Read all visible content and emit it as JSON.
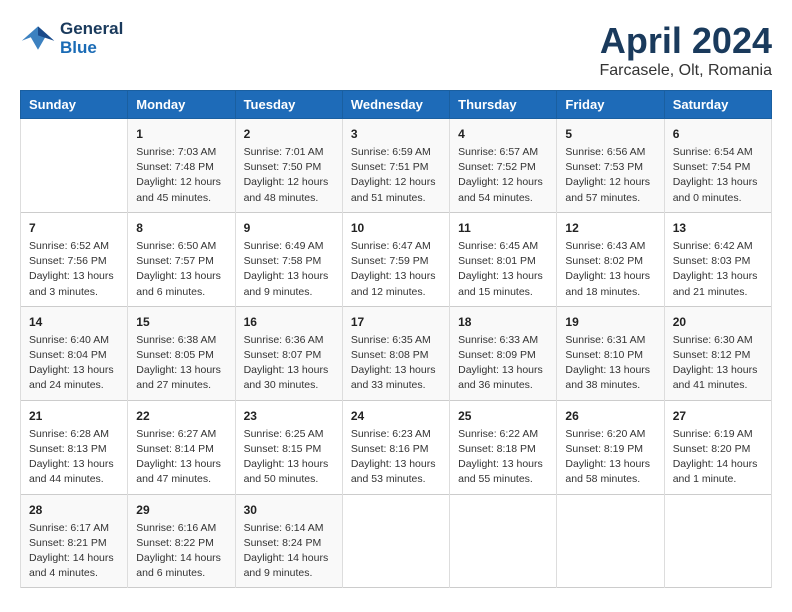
{
  "header": {
    "logo_line1": "General",
    "logo_line2": "Blue",
    "month": "April 2024",
    "location": "Farcasele, Olt, Romania"
  },
  "days_of_week": [
    "Sunday",
    "Monday",
    "Tuesday",
    "Wednesday",
    "Thursday",
    "Friday",
    "Saturday"
  ],
  "weeks": [
    [
      {
        "day": "",
        "info": ""
      },
      {
        "day": "1",
        "info": "Sunrise: 7:03 AM\nSunset: 7:48 PM\nDaylight: 12 hours\nand 45 minutes."
      },
      {
        "day": "2",
        "info": "Sunrise: 7:01 AM\nSunset: 7:50 PM\nDaylight: 12 hours\nand 48 minutes."
      },
      {
        "day": "3",
        "info": "Sunrise: 6:59 AM\nSunset: 7:51 PM\nDaylight: 12 hours\nand 51 minutes."
      },
      {
        "day": "4",
        "info": "Sunrise: 6:57 AM\nSunset: 7:52 PM\nDaylight: 12 hours\nand 54 minutes."
      },
      {
        "day": "5",
        "info": "Sunrise: 6:56 AM\nSunset: 7:53 PM\nDaylight: 12 hours\nand 57 minutes."
      },
      {
        "day": "6",
        "info": "Sunrise: 6:54 AM\nSunset: 7:54 PM\nDaylight: 13 hours\nand 0 minutes."
      }
    ],
    [
      {
        "day": "7",
        "info": "Sunrise: 6:52 AM\nSunset: 7:56 PM\nDaylight: 13 hours\nand 3 minutes."
      },
      {
        "day": "8",
        "info": "Sunrise: 6:50 AM\nSunset: 7:57 PM\nDaylight: 13 hours\nand 6 minutes."
      },
      {
        "day": "9",
        "info": "Sunrise: 6:49 AM\nSunset: 7:58 PM\nDaylight: 13 hours\nand 9 minutes."
      },
      {
        "day": "10",
        "info": "Sunrise: 6:47 AM\nSunset: 7:59 PM\nDaylight: 13 hours\nand 12 minutes."
      },
      {
        "day": "11",
        "info": "Sunrise: 6:45 AM\nSunset: 8:01 PM\nDaylight: 13 hours\nand 15 minutes."
      },
      {
        "day": "12",
        "info": "Sunrise: 6:43 AM\nSunset: 8:02 PM\nDaylight: 13 hours\nand 18 minutes."
      },
      {
        "day": "13",
        "info": "Sunrise: 6:42 AM\nSunset: 8:03 PM\nDaylight: 13 hours\nand 21 minutes."
      }
    ],
    [
      {
        "day": "14",
        "info": "Sunrise: 6:40 AM\nSunset: 8:04 PM\nDaylight: 13 hours\nand 24 minutes."
      },
      {
        "day": "15",
        "info": "Sunrise: 6:38 AM\nSunset: 8:05 PM\nDaylight: 13 hours\nand 27 minutes."
      },
      {
        "day": "16",
        "info": "Sunrise: 6:36 AM\nSunset: 8:07 PM\nDaylight: 13 hours\nand 30 minutes."
      },
      {
        "day": "17",
        "info": "Sunrise: 6:35 AM\nSunset: 8:08 PM\nDaylight: 13 hours\nand 33 minutes."
      },
      {
        "day": "18",
        "info": "Sunrise: 6:33 AM\nSunset: 8:09 PM\nDaylight: 13 hours\nand 36 minutes."
      },
      {
        "day": "19",
        "info": "Sunrise: 6:31 AM\nSunset: 8:10 PM\nDaylight: 13 hours\nand 38 minutes."
      },
      {
        "day": "20",
        "info": "Sunrise: 6:30 AM\nSunset: 8:12 PM\nDaylight: 13 hours\nand 41 minutes."
      }
    ],
    [
      {
        "day": "21",
        "info": "Sunrise: 6:28 AM\nSunset: 8:13 PM\nDaylight: 13 hours\nand 44 minutes."
      },
      {
        "day": "22",
        "info": "Sunrise: 6:27 AM\nSunset: 8:14 PM\nDaylight: 13 hours\nand 47 minutes."
      },
      {
        "day": "23",
        "info": "Sunrise: 6:25 AM\nSunset: 8:15 PM\nDaylight: 13 hours\nand 50 minutes."
      },
      {
        "day": "24",
        "info": "Sunrise: 6:23 AM\nSunset: 8:16 PM\nDaylight: 13 hours\nand 53 minutes."
      },
      {
        "day": "25",
        "info": "Sunrise: 6:22 AM\nSunset: 8:18 PM\nDaylight: 13 hours\nand 55 minutes."
      },
      {
        "day": "26",
        "info": "Sunrise: 6:20 AM\nSunset: 8:19 PM\nDaylight: 13 hours\nand 58 minutes."
      },
      {
        "day": "27",
        "info": "Sunrise: 6:19 AM\nSunset: 8:20 PM\nDaylight: 14 hours\nand 1 minute."
      }
    ],
    [
      {
        "day": "28",
        "info": "Sunrise: 6:17 AM\nSunset: 8:21 PM\nDaylight: 14 hours\nand 4 minutes."
      },
      {
        "day": "29",
        "info": "Sunrise: 6:16 AM\nSunset: 8:22 PM\nDaylight: 14 hours\nand 6 minutes."
      },
      {
        "day": "30",
        "info": "Sunrise: 6:14 AM\nSunset: 8:24 PM\nDaylight: 14 hours\nand 9 minutes."
      },
      {
        "day": "",
        "info": ""
      },
      {
        "day": "",
        "info": ""
      },
      {
        "day": "",
        "info": ""
      },
      {
        "day": "",
        "info": ""
      }
    ]
  ]
}
